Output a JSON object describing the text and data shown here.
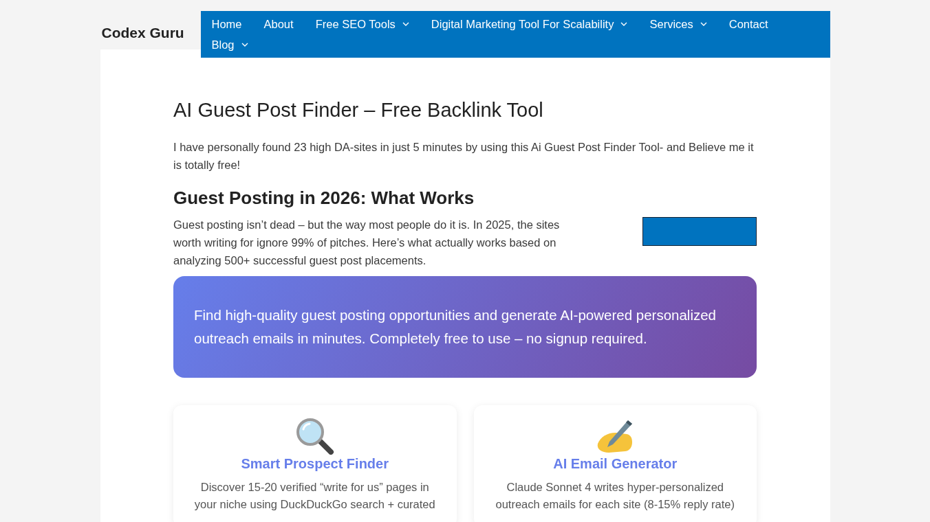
{
  "site": {
    "title": "Codex Guru"
  },
  "nav": [
    {
      "label": "Home",
      "dropdown": false
    },
    {
      "label": "About",
      "dropdown": false
    },
    {
      "label": "Free SEO Tools",
      "dropdown": true
    },
    {
      "label": "Digital Marketing Tool For Scalability",
      "dropdown": true
    },
    {
      "label": "Services",
      "dropdown": true
    },
    {
      "label": "Contact",
      "dropdown": false
    },
    {
      "label": "Blog",
      "dropdown": true
    }
  ],
  "article": {
    "title": "AI Guest Post Finder – Free Backlink Tool",
    "intro": "I have personally found 23 high DA-sites in just 5 minutes by using this Ai Guest Post Finder Tool- and Believe me it is totally free!",
    "heading": "Guest Posting in 2026: What Works",
    "body": "Guest posting isn’t dead – but the way most people do it is. In 2025, the sites worth writing for ignore 99% of pitches. Here’s what actually works based on analyzing 500+ successful guest post placements.",
    "banner": "Find high-quality guest posting opportunities and generate AI-powered personalized outreach emails in minutes. Completely free to use – no signup required."
  },
  "features": [
    {
      "kind": "search",
      "title": "Smart Prospect Finder",
      "text": "Discover 15-20 verified “write for us” pages in your niche using DuckDuckGo search + curated"
    },
    {
      "kind": "write",
      "title": "AI Email Generator",
      "text": "Claude Sonnet 4 writes hyper-personalized outreach emails for each site (8-15% reply rate)"
    }
  ]
}
